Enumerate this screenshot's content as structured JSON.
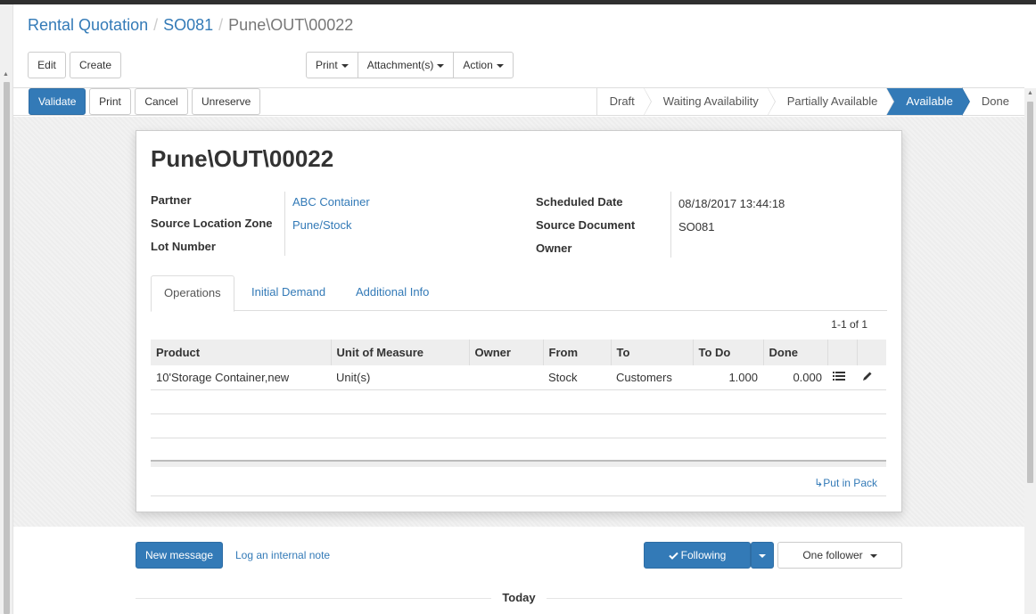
{
  "breadcrumb": {
    "items": [
      "Rental Quotation",
      "SO081"
    ],
    "current": "Pune\\OUT\\00022"
  },
  "control_panel": {
    "edit_label": "Edit",
    "create_label": "Create",
    "print_label": "Print",
    "attachments_label": "Attachment(s)",
    "action_label": "Action"
  },
  "statusbar": {
    "buttons": {
      "validate": "Validate",
      "print": "Print",
      "cancel": "Cancel",
      "unreserve": "Unreserve"
    },
    "stages": [
      "Draft",
      "Waiting Availability",
      "Partially Available",
      "Available",
      "Done"
    ],
    "active_stage": "Available"
  },
  "form": {
    "title": "Pune\\OUT\\00022",
    "left_fields": [
      {
        "label": "Partner",
        "value": "ABC Container"
      },
      {
        "label": "Source Location Zone",
        "value": "Pune/Stock"
      },
      {
        "label": "Lot Number",
        "value": ""
      }
    ],
    "right_fields": [
      {
        "label": "Scheduled Date",
        "value": "08/18/2017 13:44:18"
      },
      {
        "label": "Source Document",
        "value": "SO081"
      },
      {
        "label": "Owner",
        "value": ""
      }
    ],
    "tabs": [
      "Operations",
      "Initial Demand",
      "Additional Info"
    ],
    "active_tab": "Operations",
    "pager": "1-1 of 1",
    "table": {
      "columns": [
        "Product",
        "Unit of Measure",
        "Owner",
        "From",
        "To",
        "To Do",
        "Done"
      ],
      "rows": [
        {
          "product": "10'Storage Container,new",
          "uom": "Unit(s)",
          "owner": "",
          "from": "Stock",
          "to": "Customers",
          "todo": "1.000",
          "done": "0.000"
        }
      ]
    },
    "put_in_pack": "↳Put in Pack"
  },
  "chatter": {
    "new_message": "New message",
    "log_note": "Log an internal note",
    "following": "Following",
    "followers": "One follower",
    "today": "Today"
  },
  "colors": {
    "primary": "#337ab7",
    "link": "#337ab7"
  },
  "icons": [
    "list-icon",
    "pencil-icon",
    "check-icon",
    "caret-down-icon"
  ]
}
